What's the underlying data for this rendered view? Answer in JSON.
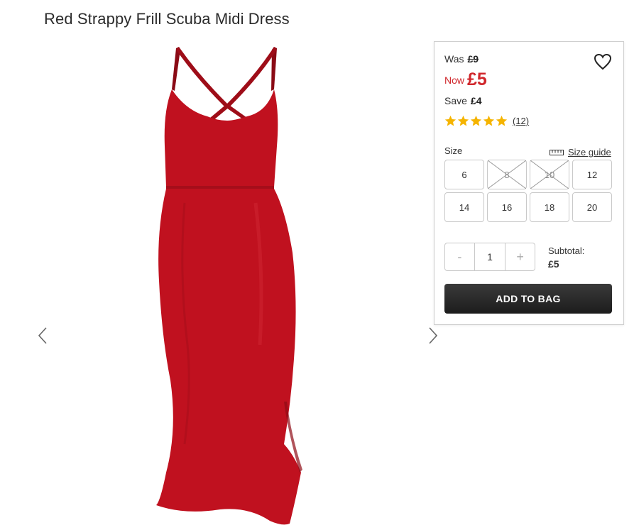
{
  "product": {
    "title": "Red Strappy Frill Scuba Midi Dress",
    "image_color": "#c0111f"
  },
  "gallery": {
    "prev_icon": "chevron-left-icon",
    "next_icon": "chevron-right-icon"
  },
  "pricing": {
    "was_label": "Was",
    "was_price": "£9",
    "now_label": "Now",
    "now_price": "£5",
    "save_label": "Save",
    "save_amount": "£4",
    "accent_color": "#d0262b"
  },
  "rating": {
    "stars": 5,
    "reviews": "(12)",
    "star_color": "#f5b400"
  },
  "size": {
    "label": "Size",
    "guide_label": "Size guide",
    "options": [
      {
        "value": "6",
        "available": true
      },
      {
        "value": "8",
        "available": false
      },
      {
        "value": "10",
        "available": false
      },
      {
        "value": "12",
        "available": true
      },
      {
        "value": "14",
        "available": true
      },
      {
        "value": "16",
        "available": true
      },
      {
        "value": "18",
        "available": true
      },
      {
        "value": "20",
        "available": true
      }
    ]
  },
  "quantity": {
    "minus": "-",
    "value": "1",
    "plus": "+"
  },
  "subtotal": {
    "label": "Subtotal:",
    "amount": "£5"
  },
  "cta": {
    "add_to_bag": "ADD TO BAG"
  }
}
